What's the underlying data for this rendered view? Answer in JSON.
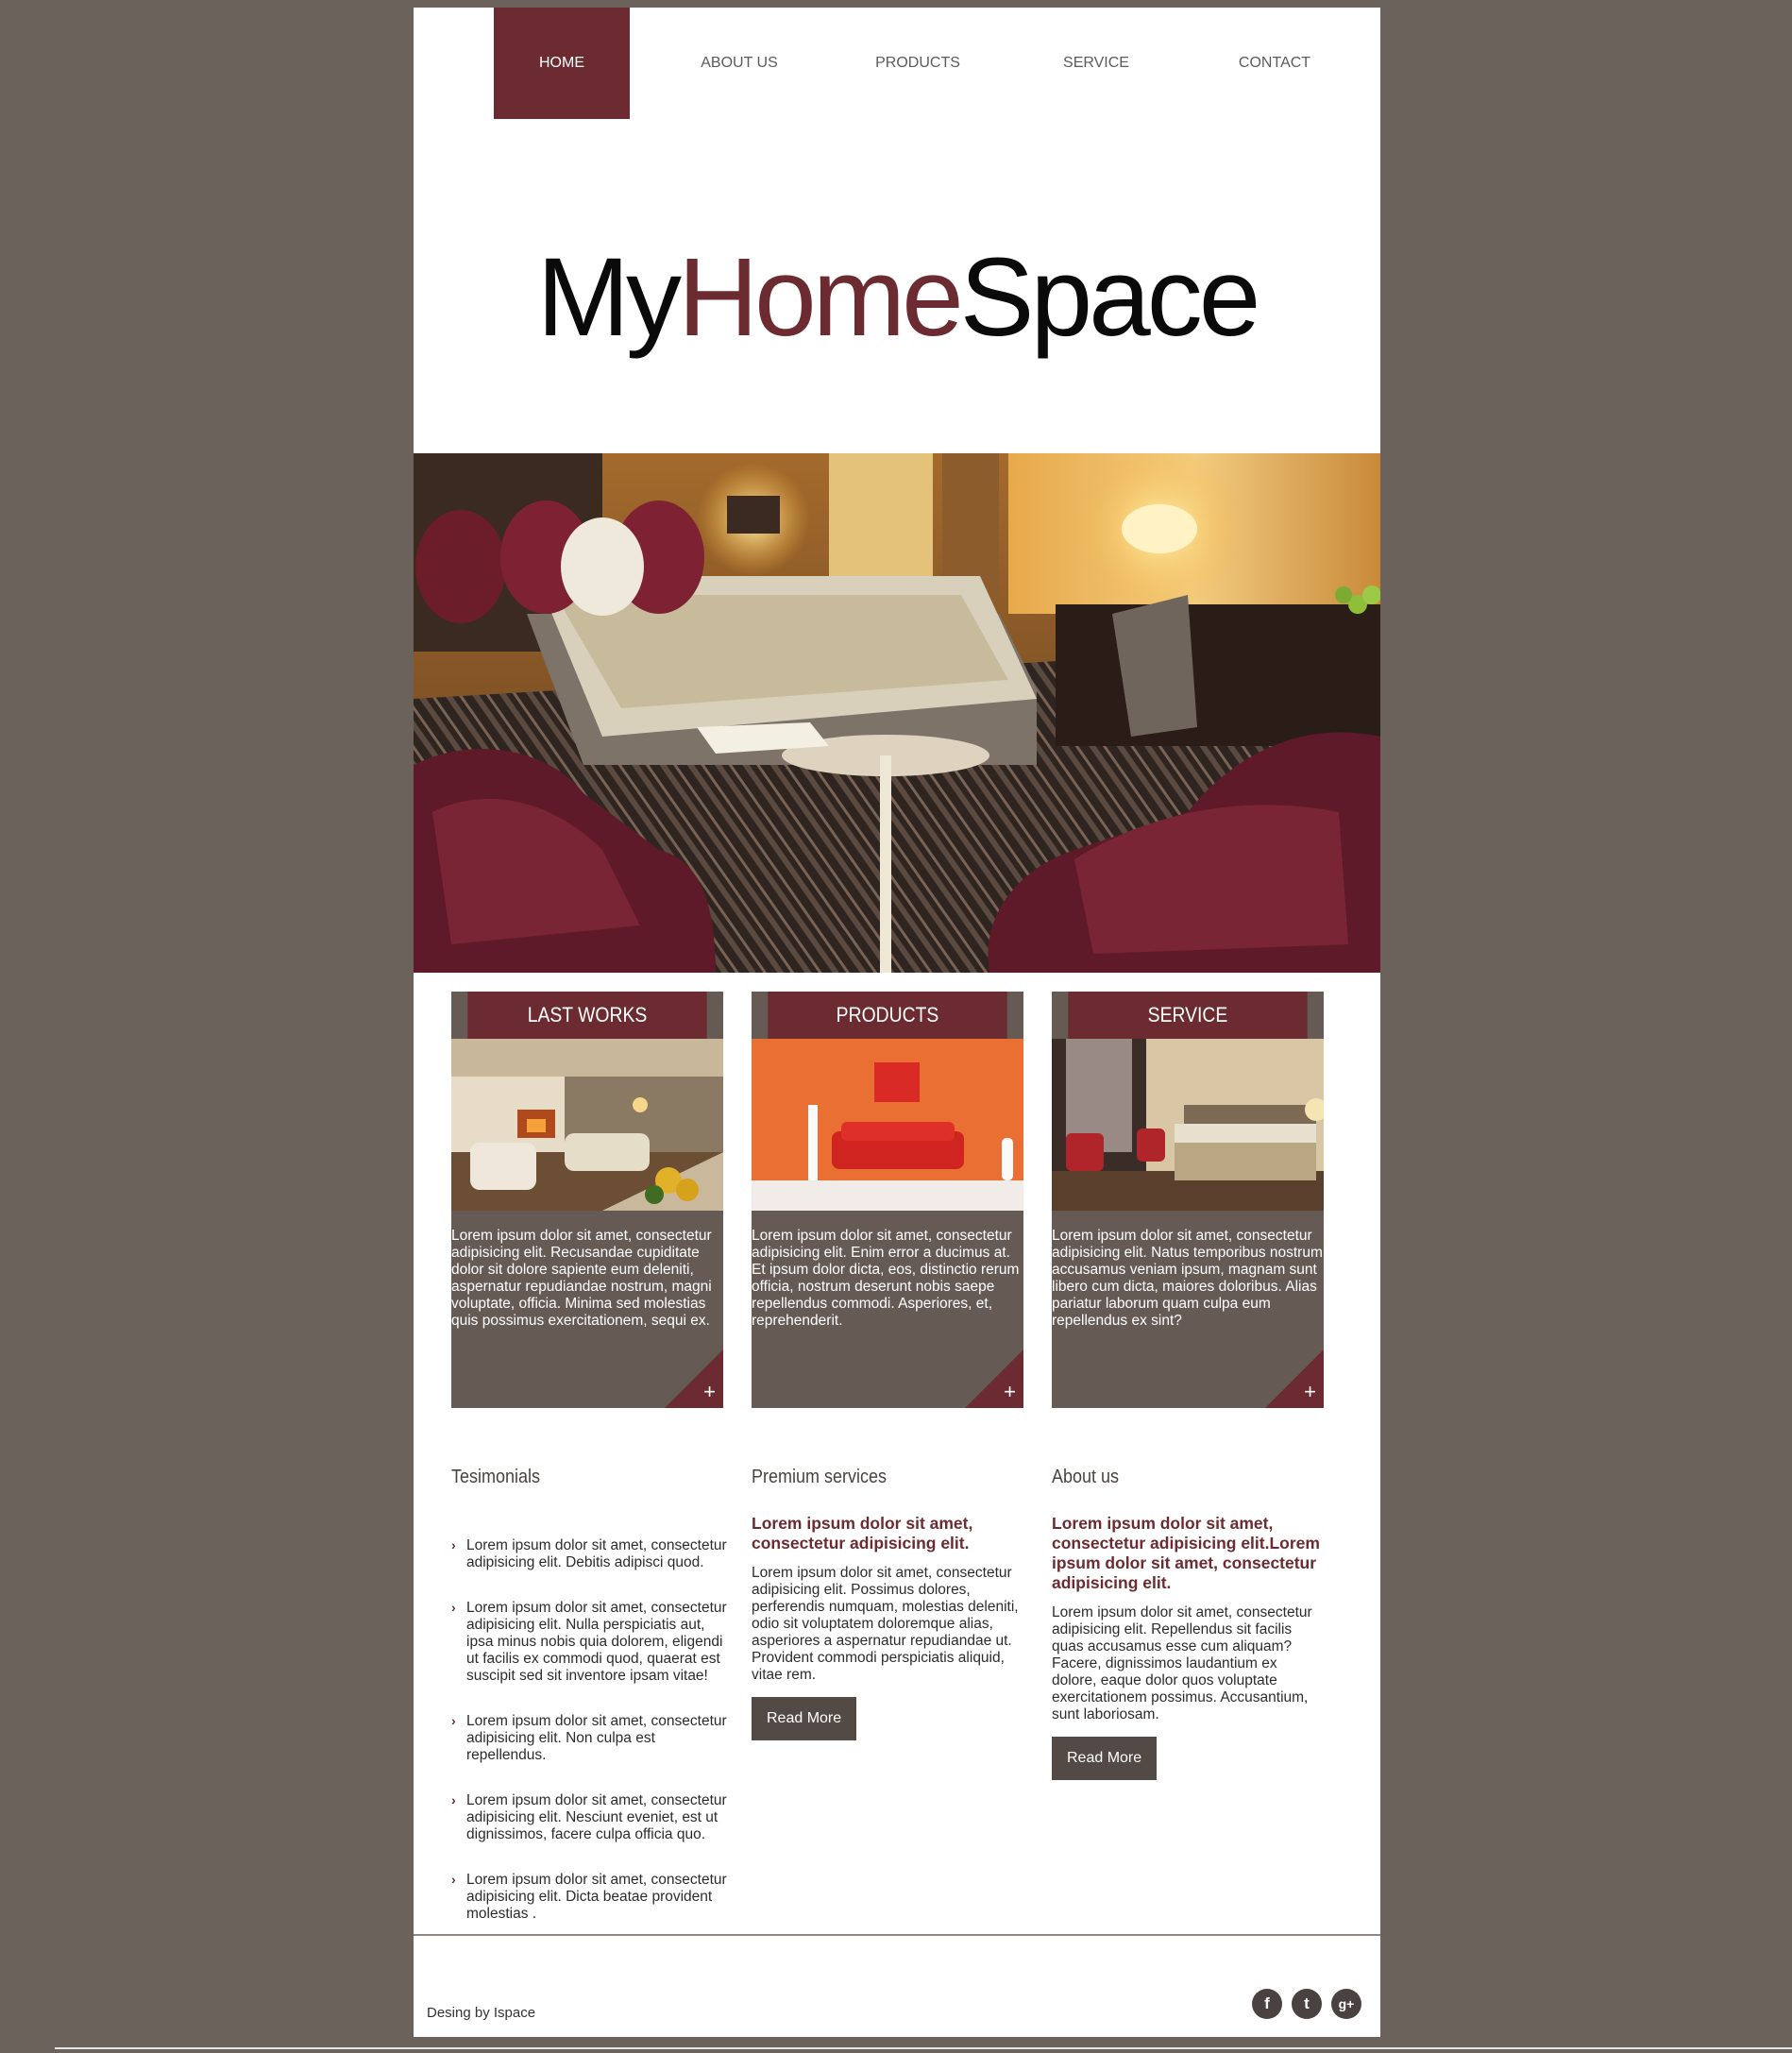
{
  "nav": {
    "items": [
      {
        "label": "HOME",
        "active": true
      },
      {
        "label": "ABOUT US",
        "active": false
      },
      {
        "label": "PRODUCTS",
        "active": false
      },
      {
        "label": "SERVICE",
        "active": false
      },
      {
        "label": "CONTACT",
        "active": false
      }
    ]
  },
  "logo": {
    "part1": "My",
    "part2": "Home",
    "part3": "Space"
  },
  "cards": [
    {
      "title": "LAST WORKS",
      "text": "Lorem ipsum dolor sit amet, consectetur adipisicing elit. Recusandae cupiditate dolor sit dolore sapiente eum deleniti, aspernatur repudiandae nostrum, magni voluptate, officia. Minima sed molestias quis possimus exercitationem, sequi ex.",
      "plus": "+"
    },
    {
      "title": "PRODUCTS",
      "text": "Lorem ipsum dolor sit amet, consectetur adipisicing elit. Enim error a ducimus at. Et ipsum dolor dicta, eos, distinctio rerum officia, nostrum deserunt nobis saepe repellendus commodi. Asperiores, et, reprehenderit.",
      "plus": "+"
    },
    {
      "title": "SERVICE",
      "text": "Lorem ipsum dolor sit amet, consectetur adipisicing elit. Natus temporibus nostrum accusamus veniam ipsum, magnam sunt libero cum dicta, maiores doloribus. Alias pariatur laborum quam culpa eum repellendus ex sint?",
      "plus": "+"
    }
  ],
  "testimonials": {
    "title": "Tesimonials",
    "items": [
      "Lorem ipsum dolor sit amet, consectetur adipisicing elit. Debitis adipisci quod.",
      "Lorem ipsum dolor sit amet, consectetur adipisicing elit. Nulla perspiciatis aut, ipsa minus nobis quia dolorem, eligendi ut facilis ex commodi quod, quaerat est suscipit sed sit inventore ipsam vitae!",
      "Lorem ipsum dolor sit amet, consectetur adipisicing elit. Non culpa est repellendus.",
      "Lorem ipsum dolor sit amet, consectetur adipisicing elit. Nesciunt eveniet, est ut dignissimos, facere culpa officia quo.",
      "Lorem ipsum dolor sit amet, consectetur adipisicing elit. Dicta beatae provident molestias ."
    ]
  },
  "premium": {
    "title": "Premium services",
    "lead": "Lorem ipsum dolor sit amet, consectetur adipisicing elit.",
    "body": "Lorem ipsum dolor sit amet, consectetur adipisicing elit. Possimus dolores, perferendis numquam, molestias deleniti, odio sit voluptatem doloremque alias, asperiores a aspernatur repudiandae ut. Provident commodi perspiciatis aliquid, vitae rem.",
    "button": "Read More"
  },
  "about": {
    "title": "About us",
    "lead": "Lorem ipsum dolor sit amet, consectetur adipisicing elit.Lorem ipsum dolor sit amet, consectetur adipisicing elit.",
    "body": "Lorem ipsum dolor sit amet, consectetur adipisicing elit. Repellendus sit facilis quas accusamus esse cum aliquam? Facere, dignissimos laudantium ex dolore, eaque dolor quos voluptate exercitationem possimus. Accusantium, sunt laboriosam.",
    "button": "Read More"
  },
  "footer": {
    "credit": "Desing by Ispace",
    "social": [
      {
        "icon": "facebook-icon",
        "glyph": "f"
      },
      {
        "icon": "twitter-icon",
        "glyph": "t"
      },
      {
        "icon": "google-plus-icon",
        "glyph": "g+"
      }
    ]
  },
  "colors": {
    "accent": "#6b2b30",
    "background": "#6b625c",
    "card": "#665a55",
    "button": "#544a45"
  }
}
